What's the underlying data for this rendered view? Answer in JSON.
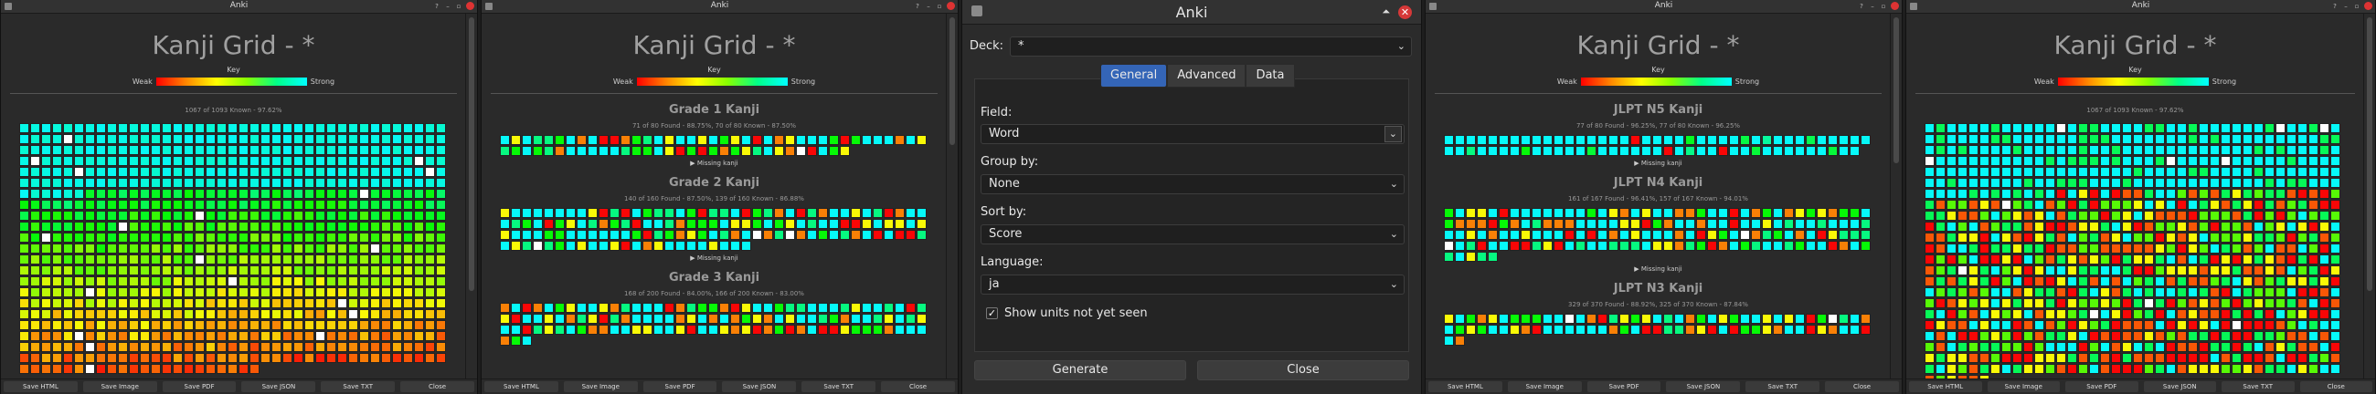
{
  "windows": [
    {
      "title": "Anki",
      "heading": "Kanji Grid - *",
      "key_label": "Key",
      "weak": "Weak",
      "strong": "Strong",
      "stat": "1067 of 1093 Known - 97.62%",
      "sections": []
    },
    {
      "title": "Anki",
      "heading": "Kanji Grid - *",
      "key_label": "Key",
      "weak": "Weak",
      "strong": "Strong",
      "stat": "",
      "sections": [
        {
          "title": "Grade 1 Kanji",
          "stat": "71 of 80 Found - 88.75%, 70 of 80 Known - 87.50%",
          "missing": "▶ Missing kanji"
        },
        {
          "title": "Grade 2 Kanji",
          "stat": "140 of 160 Found - 87.50%, 139 of 160 Known - 86.88%",
          "missing": "▶ Missing kanji"
        },
        {
          "title": "Grade 3 Kanji",
          "stat": "168 of 200 Found - 84.00%, 166 of 200 Known - 83.00%",
          "missing": ""
        }
      ]
    },
    {
      "title": "Anki",
      "heading": "Kanji Grid - *",
      "key_label": "Key",
      "weak": "Weak",
      "strong": "Strong",
      "stat": "",
      "sections": [
        {
          "title": "JLPT N5 Kanji",
          "stat": "77 of 80 Found - 96.25%, 77 of 80 Known - 96.25%",
          "missing": "▶ Missing kanji"
        },
        {
          "title": "JLPT N4 Kanji",
          "stat": "161 of 167 Found - 96.41%, 157 of 167 Known - 94.01%",
          "missing": "▶ Missing kanji"
        },
        {
          "title": "JLPT N3 Kanji",
          "stat": "329 of 370 Found - 88.92%, 325 of 370 Known - 87.84%",
          "missing": ""
        }
      ]
    },
    {
      "title": "Anki",
      "heading": "Kanji Grid - *",
      "key_label": "Key",
      "weak": "Weak",
      "strong": "Strong",
      "stat": "1067 of 1093 Known - 97.62%",
      "sections": []
    }
  ],
  "footer_buttons": [
    "Save HTML",
    "Save Image",
    "Save PDF",
    "Save JSON",
    "Save TXT",
    "Close"
  ],
  "dialog": {
    "title": "Anki",
    "deck_label": "Deck:",
    "deck_value": "*",
    "tabs": [
      "General",
      "Advanced",
      "Data"
    ],
    "active_tab": "General",
    "field_label": "Field:",
    "field_value": "Word",
    "groupby_label": "Group by:",
    "groupby_value": "None",
    "sortby_label": "Sort by:",
    "sortby_value": "Score",
    "language_label": "Language:",
    "language_value": "ja",
    "checkbox_label": "Show units not yet seen",
    "checkbox_checked": true,
    "generate_label": "Generate",
    "close_label": "Close"
  },
  "colors": {
    "accent": "#3465b7",
    "close": "#d63838"
  }
}
